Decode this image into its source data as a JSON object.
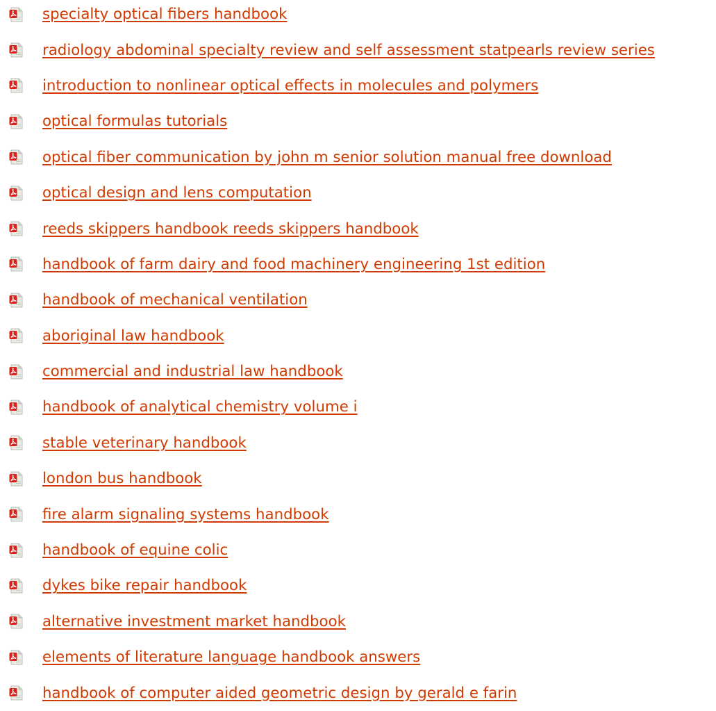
{
  "colors": {
    "link": "#d13a00",
    "icon_red": "#d8221b",
    "icon_paper": "#e9ebe5"
  },
  "icon": "pdf-file-icon",
  "documents": [
    {
      "title": "specialty optical fibers handbook"
    },
    {
      "title": "radiology abdominal specialty review and self assessment statpearls review series"
    },
    {
      "title": "introduction to nonlinear optical effects in molecules and polymers"
    },
    {
      "title": "optical formulas tutorials"
    },
    {
      "title": "optical fiber communication by john m senior solution manual free download"
    },
    {
      "title": "optical design and lens computation"
    },
    {
      "title": "reeds skippers handbook reeds skippers handbook"
    },
    {
      "title": "handbook of farm dairy and food machinery engineering 1st edition"
    },
    {
      "title": "handbook of mechanical ventilation"
    },
    {
      "title": "aboriginal law handbook"
    },
    {
      "title": "commercial and industrial law handbook"
    },
    {
      "title": "handbook of analytical chemistry volume i"
    },
    {
      "title": "stable veterinary handbook"
    },
    {
      "title": "london bus handbook"
    },
    {
      "title": "fire alarm signaling systems handbook"
    },
    {
      "title": "handbook of equine colic"
    },
    {
      "title": "dykes bike repair handbook"
    },
    {
      "title": "alternative investment market handbook"
    },
    {
      "title": "elements of literature language handbook answers"
    },
    {
      "title": "handbook of computer aided geometric design by gerald e farin"
    }
  ]
}
